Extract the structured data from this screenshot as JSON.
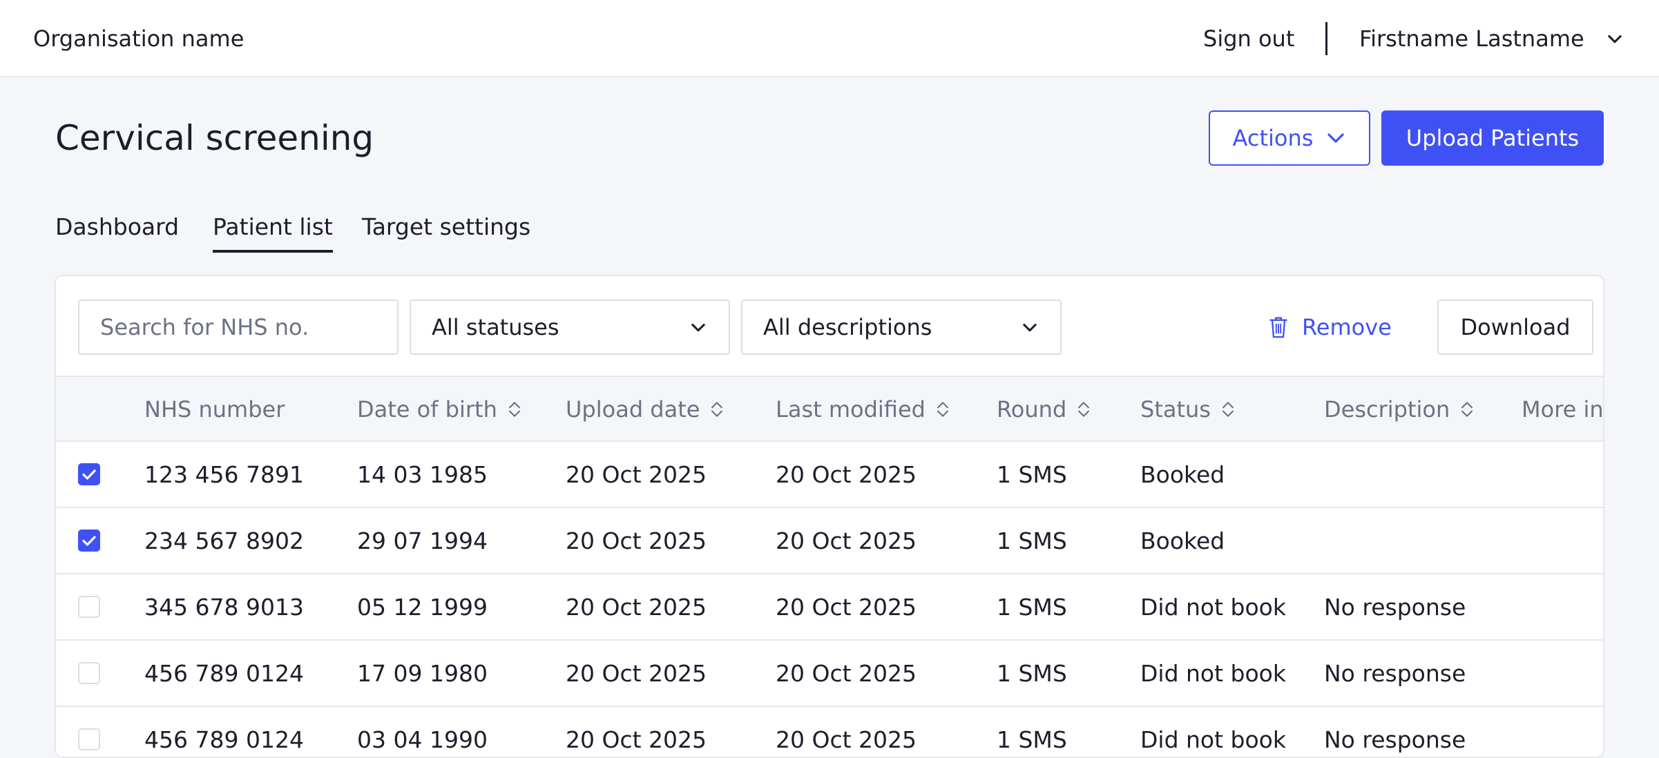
{
  "header": {
    "org_name": "Organisation name",
    "sign_out": "Sign out",
    "user_name": "Firstname Lastname"
  },
  "page": {
    "title": "Cervical screening",
    "actions_label": "Actions",
    "upload_label": "Upload Patients"
  },
  "tabs": [
    {
      "label": "Dashboard",
      "active": false
    },
    {
      "label": "Patient list",
      "active": true
    },
    {
      "label": "Target settings",
      "active": false
    }
  ],
  "filters": {
    "search_placeholder": "Search for NHS no.",
    "status_select": "All statuses",
    "description_select": "All descriptions",
    "remove_label": "Remove",
    "download_label": "Download"
  },
  "table": {
    "columns": [
      "NHS number",
      "Date of birth",
      "Upload date",
      "Last modified",
      "Round",
      "Status",
      "Description",
      "More in"
    ],
    "rows": [
      {
        "checked": true,
        "nhs": "123 456 7891",
        "dob": "14 03 1985",
        "upload": "20 Oct 2025",
        "modified": "20 Oct 2025",
        "round": "1 SMS",
        "status": "Booked",
        "description": ""
      },
      {
        "checked": true,
        "nhs": "234 567 8902",
        "dob": "29 07 1994",
        "upload": "20 Oct 2025",
        "modified": "20 Oct 2025",
        "round": "1 SMS",
        "status": "Booked",
        "description": ""
      },
      {
        "checked": false,
        "nhs": "345 678 9013",
        "dob": "05 12 1999",
        "upload": "20 Oct 2025",
        "modified": "20 Oct 2025",
        "round": "1 SMS",
        "status": "Did not book",
        "description": "No response"
      },
      {
        "checked": false,
        "nhs": "456 789 0124",
        "dob": "17 09 1980",
        "upload": "20 Oct 2025",
        "modified": "20 Oct 2025",
        "round": "1 SMS",
        "status": "Did not book",
        "description": "No response"
      },
      {
        "checked": false,
        "nhs": "456 789 0124",
        "dob": "03 04 1990",
        "upload": "20 Oct 2025",
        "modified": "20 Oct 2025",
        "round": "1 SMS",
        "status": "Did not book",
        "description": "No response"
      }
    ]
  },
  "colors": {
    "accent": "#3f51f5",
    "text": "#1d1d2c",
    "muted": "#6e7184",
    "border": "#e6e7ec",
    "background": "#f5f6f9"
  },
  "icons": {
    "user_menu": "chevron-down-icon",
    "actions": "chevron-down-icon",
    "selects": "chevron-down-icon",
    "remove": "trash-icon",
    "sort": "sort-icon",
    "checkbox": "check-icon"
  }
}
